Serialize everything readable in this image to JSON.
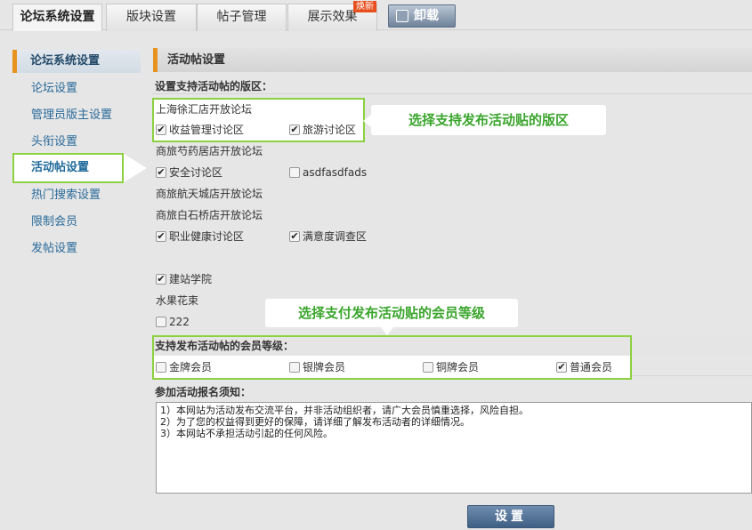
{
  "tabs": [
    {
      "label": "论坛系统设置",
      "active": true
    },
    {
      "label": "版块设置",
      "active": false
    },
    {
      "label": "帖子管理",
      "active": false
    },
    {
      "label": "展示效果",
      "active": false,
      "badge": "焕新"
    }
  ],
  "uninstall_label": "卸载",
  "sidebar": {
    "header": "论坛系统设置",
    "items": [
      "论坛设置",
      "管理员版主设置",
      "头衔设置",
      "活动帖设置",
      "热门搜索设置",
      "限制会员",
      "发帖设置"
    ],
    "active_index": 3
  },
  "section_title": "活动帖设置",
  "forums_label": "设置支持活动帖的版区：",
  "forum_groups": [
    {
      "name": "上海徐汇店开放论坛",
      "boards": [
        {
          "label": "收益管理讨论区",
          "checked": true
        },
        {
          "label": "旅游讨论区",
          "checked": true
        }
      ]
    },
    {
      "name": "商旅芍药居店开放论坛",
      "boards": [
        {
          "label": "安全讨论区",
          "checked": true
        },
        {
          "label": "asdfasdfads",
          "checked": false
        }
      ]
    },
    {
      "name": "商旅航天城店开放论坛",
      "boards": []
    },
    {
      "name": "商旅白石桥店开放论坛",
      "boards": [
        {
          "label": "职业健康讨论区",
          "checked": true
        },
        {
          "label": "满意度调查区",
          "checked": true
        }
      ]
    },
    {
      "name": "",
      "boards": [
        {
          "label": "建站学院",
          "checked": true
        }
      ]
    },
    {
      "name": "水果花束",
      "boards": [
        {
          "label": "222",
          "checked": false
        }
      ]
    }
  ],
  "callout_forums": "选择支持发布活动贴的版区",
  "callout_levels": "选择支付发布活动贴的会员等级",
  "levels_label": "支持发布活动帖的会员等级：",
  "levels": [
    {
      "label": "金牌会员",
      "checked": false
    },
    {
      "label": "银牌会员",
      "checked": false
    },
    {
      "label": "铜牌会员",
      "checked": false
    },
    {
      "label": "普通会员",
      "checked": true
    }
  ],
  "notice_label": "参加活动报名须知：",
  "notice_lines": [
    "1）本网站为活动发布交流平台，并非活动组织者，请广大会员慎重选择，风险自担。",
    "2）为了您的权益得到更好的保障，请详细了解发布活动者的详细情况。",
    "3）本网站不承担活动引起的任何风险。"
  ],
  "submit_label": "设置",
  "colors": {
    "highlight": "#8cd13f",
    "callout_text": "#3aa52c",
    "accent": "#e8931f",
    "link": "#2a6a9a"
  }
}
